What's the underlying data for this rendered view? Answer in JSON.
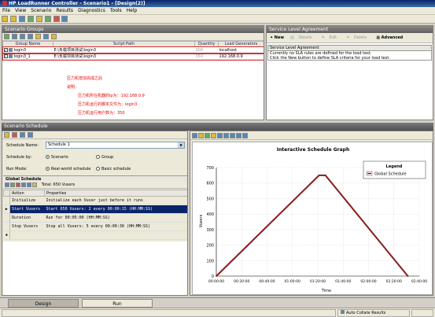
{
  "window": {
    "title": "HP LoadRunner Controller - Scenario1 - [Design(2)]"
  },
  "menu": [
    "File",
    "View",
    "Scenario",
    "Results",
    "Diagnostics",
    "Tools",
    "Help"
  ],
  "scenario_groups": {
    "title": "Scenario Groups",
    "columns": [
      "Group Name",
      "Script Path",
      "Quantity",
      "Load Generators"
    ],
    "rows": [
      {
        "name": "login3",
        "path": "E:\\负载项目测试\\login3",
        "quantity": "300",
        "generator": "localhost"
      },
      {
        "name": "login3_1",
        "path": "E:\\负载项目测试\\login3",
        "quantity": "350",
        "generator": "192.168.0.9"
      }
    ],
    "notes": [
      "压力机增加完成之后",
      "说明：",
      "压力机所在机器的ip为：192.168.0.9",
      "压力机运行的脚本文件为：login3",
      "压力机运行用户数为：350"
    ]
  },
  "sla": {
    "title": "Service Level Agreement",
    "toolbar": {
      "new": "New",
      "details": "Details",
      "edit": "Edit",
      "delete": "Delete",
      "advanced": "Advanced"
    },
    "box_header": "Service Level Agreement",
    "lines": [
      "Currently no SLA rules are defined for the load test.",
      "Click the New button to define SLA criteria for your load test."
    ]
  },
  "schedule": {
    "title": "Scenario Schedule",
    "name_label": "Schedule Name:",
    "name_value": "Schedule 1",
    "by_label": "Schedule by:",
    "by_options": [
      "Scenario",
      "Group"
    ],
    "mode_label": "Run Mode:",
    "mode_options": [
      "Real-world schedule",
      "Basic schedule"
    ]
  },
  "global_schedule": {
    "title": "Global Schedule",
    "total": "Total: 650 Vusers",
    "columns": [
      "Action",
      "Properties"
    ],
    "rows": [
      {
        "action": "Initialize",
        "props": "Initialize each Vuser just before it runs",
        "selected": false
      },
      {
        "action": "Start Vusers",
        "props": "Start 650 Vusers: 2 every 00:00:15 (HH:MM:SS)",
        "selected": true
      },
      {
        "action": "Duration",
        "props": "Run for 00:05:00 (HH:MM:SS)",
        "selected": false
      },
      {
        "action": "Stop Vusers",
        "props": "Stop all Vusers: 5 every 00:00:30 (HH:MM:SS)",
        "selected": false
      }
    ]
  },
  "graph": {
    "legend_title": "Legend"
  },
  "chart_data": {
    "type": "line",
    "title": "Interactive Schedule Graph",
    "xlabel": "Time",
    "ylabel": "Vusers",
    "ylim": [
      0,
      700
    ],
    "yticks": [
      0,
      100,
      200,
      300,
      400,
      500,
      600,
      700
    ],
    "xticks": [
      "00:00:00",
      "00:20:00",
      "00:40:00",
      "01:00:00",
      "01:20:00",
      "01:40:00",
      "02:00:00",
      "02:20:00",
      "02:40:00"
    ],
    "xlim_minutes": [
      0,
      160
    ],
    "grid": true,
    "legend_position": "top-right",
    "series": [
      {
        "name": "Global Schedule",
        "color": "#8b1a1a",
        "x_minutes": [
          0,
          81,
          86,
          151
        ],
        "values": [
          0,
          650,
          650,
          0
        ]
      }
    ]
  },
  "tabs": {
    "design": "Design",
    "run": "Run"
  },
  "status": {
    "collate": "Auto Collate Results"
  }
}
